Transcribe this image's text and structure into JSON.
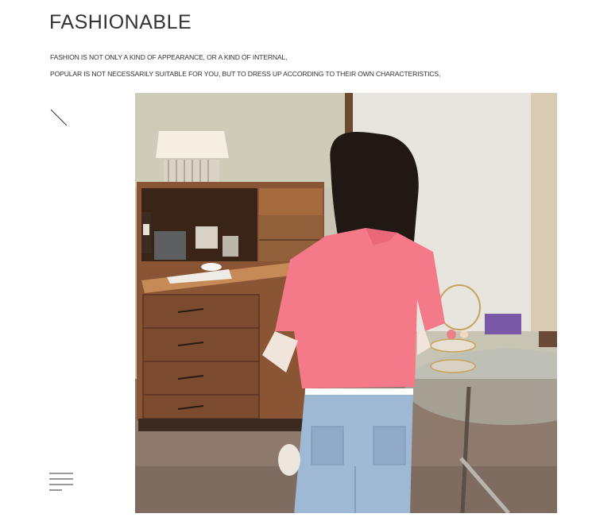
{
  "header": {
    "title": "FASHIONABLE",
    "subtitle_line1": "FASHION IS NOT ONLY A KIND OF APPEARANCE, OR A KIND OF INTERNAL,",
    "subtitle_line2": "POPULAR IS NOT NECESSARILY SUITABLE FOR YOU, BUT TO DRESS UP ACCORDING TO THEIR OWN CHARACTERISTICS,"
  },
  "decor": {
    "top_icon": "diagonal-line-icon",
    "bottom_icon": "menu-lines-icon"
  },
  "photo": {
    "subject": "model-photo",
    "shirt_color": "#f47a8a",
    "jeans_color": "#9fb8d4",
    "cabinet_color": "#8a5535"
  }
}
